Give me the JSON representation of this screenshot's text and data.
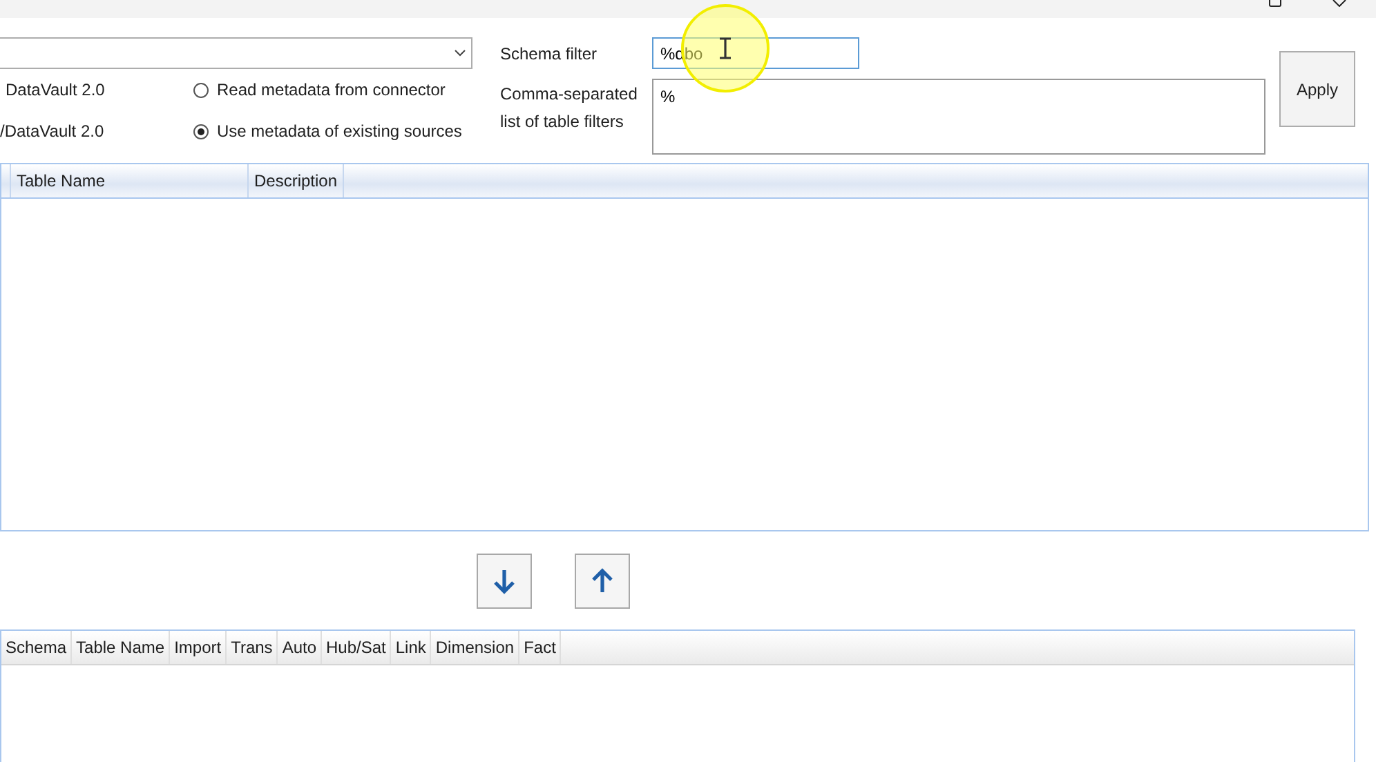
{
  "options": [
    {
      "label": "DataVault 2.0",
      "radio_label": "Read metadata from connector",
      "selected": false
    },
    {
      "label": "/DataVault 2.0",
      "radio_label": "Use metadata of existing sources",
      "selected": true
    }
  ],
  "schema_filter": {
    "label": "Schema filter",
    "value": "%dbo"
  },
  "table_filters": {
    "label": "Comma-separated list of table filters",
    "value": "%"
  },
  "apply_button": "Apply",
  "source_table": {
    "columns": [
      "Table Name",
      "Description"
    ]
  },
  "move_buttons": [
    {
      "kind": "down"
    },
    {
      "kind": "up"
    }
  ],
  "target_table": {
    "columns": [
      "Schema",
      "Table Name",
      "Import",
      "Trans",
      "Auto",
      "Hub/Sat",
      "Link",
      "Dimension",
      "Fact"
    ]
  }
}
